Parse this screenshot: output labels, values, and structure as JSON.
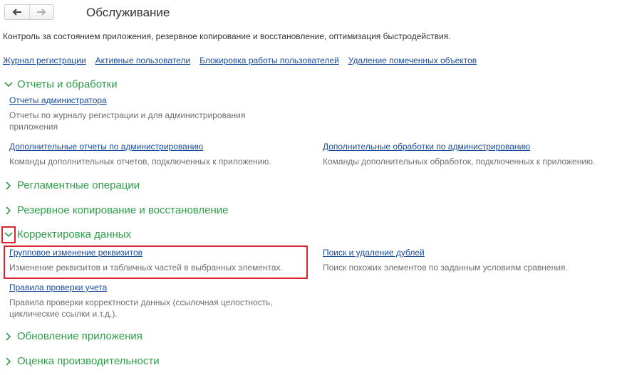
{
  "header": {
    "title": "Обслуживание",
    "back_icon": "arrow-left-icon",
    "forward_icon": "arrow-right-icon"
  },
  "description": "Контроль за состоянием приложения, резервное копирование и восстановление, оптимизация быстродействия.",
  "top_links": [
    "Журнал регистрации",
    "Активные пользователи",
    "Блокировка работы пользователей",
    "Удаление помеченных объектов"
  ],
  "sections": {
    "reports": {
      "title": "Отчеты и обработки",
      "expanded": true,
      "items": {
        "admin_reports": {
          "link": "Отчеты администратора",
          "desc": "Отчеты по журналу регистрации и для администрирования приложения"
        },
        "extra_reports": {
          "link": "Дополнительные отчеты по администрированию",
          "desc": "Команды дополнительных отчетов, подключенных к приложению."
        },
        "extra_processing": {
          "link": "Дополнительные обработки по администрированию",
          "desc": "Команды дополнительных обработок, подключенных к приложению."
        }
      }
    },
    "routine": {
      "title": "Регламентные операции",
      "expanded": false
    },
    "backup": {
      "title": "Резервное копирование и восстановление",
      "expanded": false
    },
    "data_correction": {
      "title": "Корректировка данных",
      "expanded": true,
      "items": {
        "group_change": {
          "link": "Групповое изменение реквизитов",
          "desc": "Изменение реквизитов и табличных частей в выбранных элементах."
        },
        "duplicates": {
          "link": "Поиск и удаление дублей",
          "desc": "Поиск похожих элементов по заданным условиям сравнения."
        },
        "accounting_rules": {
          "link": "Правила проверки учета",
          "desc": "Правила проверки корректности данных (ссылочная целостность, циклические ссылки и.т.д.)."
        }
      }
    },
    "update": {
      "title": "Обновление приложения",
      "expanded": false
    },
    "performance": {
      "title": "Оценка производительности",
      "expanded": false
    }
  },
  "colors": {
    "section_title": "#2e9e4a",
    "link": "#1a4b9b",
    "description": "#6f6f6f",
    "highlight": "#d9232d"
  }
}
